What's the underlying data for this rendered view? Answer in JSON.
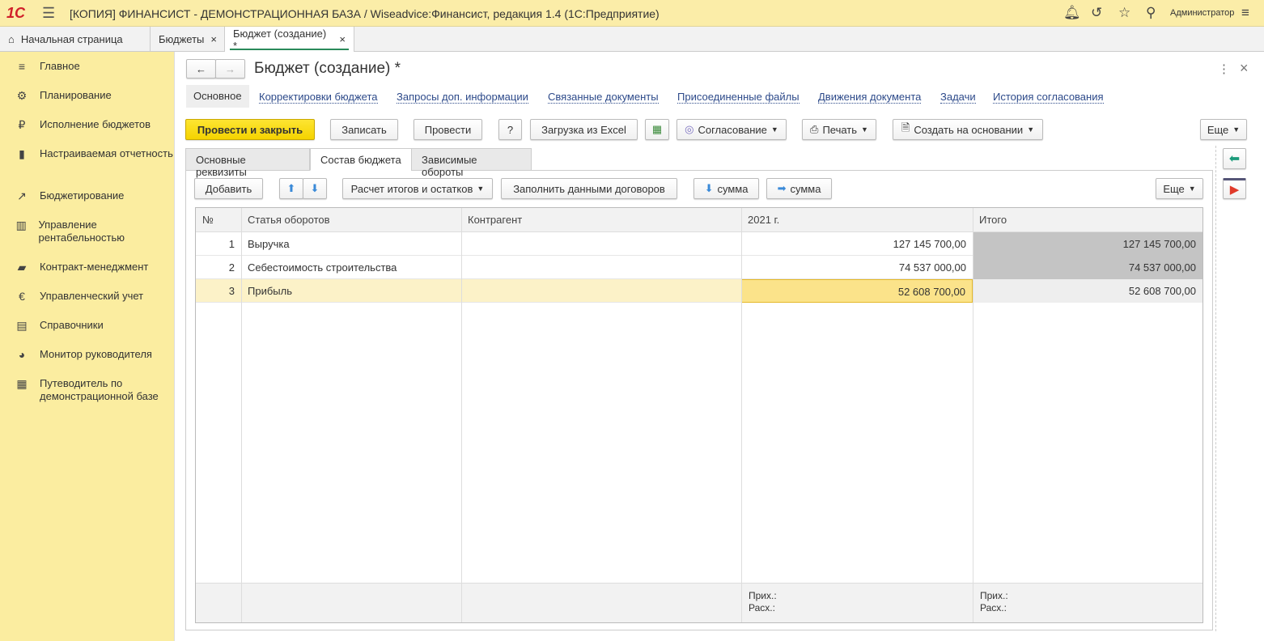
{
  "titlebar": {
    "logo": "1С",
    "title": "[КОПИЯ] ФИНАНСИСТ - ДЕМОНСТРАЦИОННАЯ БАЗА / Wiseadvice:Финансист, редакция 1.4  (1С:Предприятие)",
    "user": "Администратор"
  },
  "window_tabs": [
    {
      "label": "Начальная страница"
    },
    {
      "label": "Бюджеты"
    },
    {
      "label": "Бюджет (создание) *"
    }
  ],
  "sidebar": {
    "items": [
      {
        "label": "Главное",
        "icon": "menu-icon"
      },
      {
        "label": "Планирование",
        "icon": "planning-icon"
      },
      {
        "label": "Исполнение бюджетов",
        "icon": "ruble-icon"
      },
      {
        "label": "Настраиваемая отчетность",
        "icon": "bar-chart-icon"
      },
      {
        "label": "Бюджетирование",
        "icon": "trend-icon"
      },
      {
        "label": "Управление рентабельностью",
        "icon": "chart-icon"
      },
      {
        "label": "Контракт-менеджмент",
        "icon": "briefcase-icon"
      },
      {
        "label": "Управленческий учет",
        "icon": "euro-icon"
      },
      {
        "label": "Справочники",
        "icon": "books-icon"
      },
      {
        "label": "Монитор руководителя",
        "icon": "pie-icon"
      },
      {
        "label": "Путеводитель по демонстрационной базе",
        "icon": "grid-icon"
      }
    ]
  },
  "form": {
    "title": "Бюджет (создание) *",
    "links": [
      "Основное",
      "Корректировки бюджета",
      "Запросы доп. информации",
      "Связанные документы",
      "Присоединенные файлы",
      "Движения документа",
      "Задачи",
      "История согласования"
    ],
    "toolbar": {
      "post_close": "Провести и закрыть",
      "save": "Записать",
      "post": "Провести",
      "help": "?",
      "excel": "Загрузка из Excel",
      "approval": "Согласование",
      "print": "Печать",
      "create_based": "Создать на основании",
      "more": "Еще"
    },
    "tabs": [
      "Основные реквизиты",
      "Состав бюджета",
      "Зависимые обороты"
    ],
    "table_toolbar": {
      "add": "Добавить",
      "calc": "Расчет итогов и остатков",
      "fill": "Заполнить данными договоров",
      "sum_down": "сумма",
      "sum_right": "сумма",
      "more": "Еще"
    },
    "table": {
      "headers": [
        "№",
        "Статья оборотов",
        "Контрагент",
        "2021 г.",
        "Итого"
      ],
      "rows": [
        [
          "1",
          "Выручка",
          "",
          "127 145 700,00",
          "127 145 700,00"
        ],
        [
          "2",
          "Себестоимость строительства",
          "",
          "74 537 000,00",
          "74 537 000,00"
        ],
        [
          "3",
          "Прибыль",
          "",
          "52 608 700,00",
          "52 608 700,00"
        ]
      ],
      "footer": {
        "in": "Прих.:",
        "out": "Расх.:"
      }
    }
  }
}
